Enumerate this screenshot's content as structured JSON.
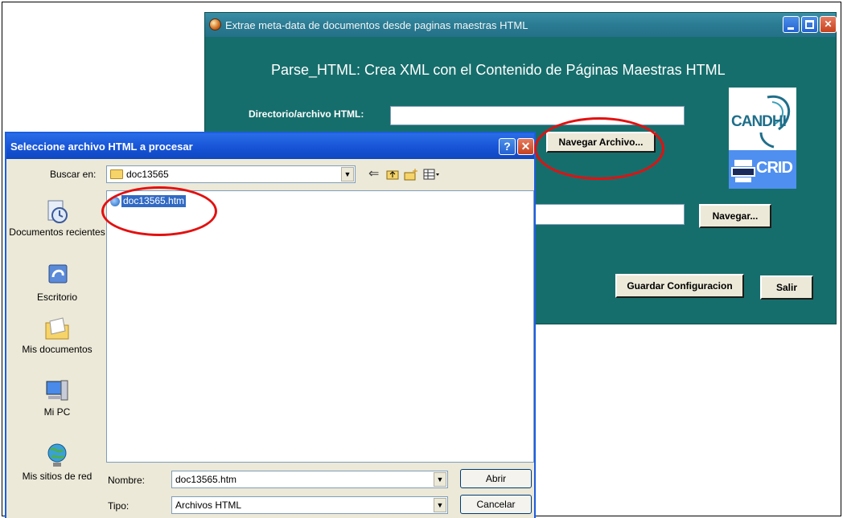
{
  "main_window": {
    "title": "Extrae meta-data de documentos desde paginas maestras HTML",
    "headline": "Parse_HTML: Crea XML con el Contenido de Páginas Maestras HTML",
    "dir_label": "Directorio/archivo HTML:",
    "dir_value": "",
    "browse_file_button": "Navegar Archivo...",
    "browse_button": "Navegar...",
    "save_config_button": "Guardar Configuracion",
    "exit_button": "Salir",
    "logo_top": "CANDHI",
    "logo_bottom": "CRID"
  },
  "dialog": {
    "title": "Seleccione archivo HTML a procesar",
    "help_glyph": "?",
    "close_glyph": "✕",
    "lookin_label": "Buscar en:",
    "lookin_value": "doc13565",
    "places": [
      "Documentos recientes",
      "Escritorio",
      "Mis documentos",
      "Mi PC",
      "Mis sitios de red"
    ],
    "files": [
      "doc13565.htm"
    ],
    "name_label": "Nombre:",
    "name_value": "doc13565.htm",
    "type_label": "Tipo:",
    "type_value": "Archivos HTML",
    "open_button": "Abrir",
    "cancel_button": "Cancelar"
  },
  "colors": {
    "main_background": "#166e6c",
    "dialog_title_bar": "#1552d4",
    "selection": "#316ac5",
    "annotation": "#e31010"
  },
  "icons": [
    "app-icon",
    "minimize-icon",
    "maximize-icon",
    "close-icon",
    "help-icon",
    "folder-icon",
    "back-icon",
    "up-folder-icon",
    "new-folder-icon",
    "views-menu-icon",
    "recent-documents-icon",
    "desktop-icon",
    "my-documents-icon",
    "my-computer-icon",
    "network-places-icon",
    "html-file-icon",
    "dropdown-arrow-icon"
  ]
}
